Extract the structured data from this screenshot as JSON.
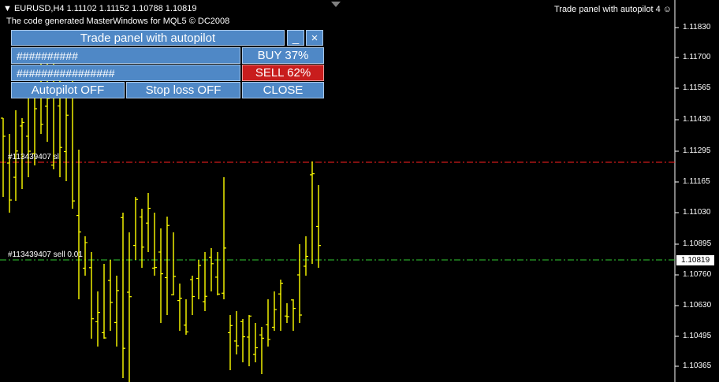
{
  "chart": {
    "symbol_info": "EURUSD,H4  1.11102 1.11152 1.10788 1.10819",
    "note": "The code generated MasterWindows for MQL5 © DC2008",
    "indicator_label": "Trade panel with autopilot 4",
    "price_axis": [
      "1.11830",
      "1.11700",
      "1.11565",
      "1.11430",
      "1.11295",
      "1.11165",
      "1.11030",
      "1.10895",
      "1.10760",
      "1.10630",
      "1.10495",
      "1.10365"
    ],
    "current_price": "1.10819",
    "orders": {
      "sl_label": "#113439407 sl",
      "sell_label": "#113439407 sell 0.01"
    },
    "colors": {
      "bars": "#ffff00",
      "sl_line": "#ff2020",
      "order_line": "#32cd32",
      "panel": "#4f88c6",
      "sell_button": "#c81d1d"
    }
  },
  "panel": {
    "title": "Trade panel with autopilot",
    "minimize_label": "_",
    "close_x_label": "×",
    "buy_field": "##########",
    "sell_field": "################",
    "buy_button": "BUY 37%",
    "sell_button": "SELL 62%",
    "autopilot_button": "Autopilot  OFF",
    "stoploss_button": "Stop loss  OFF",
    "close_button": "CLOSE"
  }
}
